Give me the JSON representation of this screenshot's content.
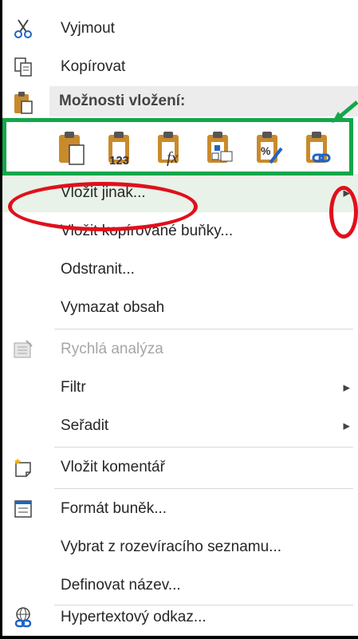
{
  "menu": {
    "cut_label": "Vyjmout",
    "copy_label": "Kopírovat",
    "paste_options_header": "Možnosti vložení:",
    "paste_special_label": "Vložit jinak...",
    "insert_copied_label": "Vložit kopírované buňky...",
    "delete_label": "Odstranit...",
    "clear_contents_label": "Vymazat obsah",
    "quick_analysis_label": "Rychlá analýza",
    "filter_label": "Filtr",
    "sort_label": "Seřadit",
    "insert_comment_label": "Vložit komentář",
    "format_cells_label": "Formát buněk...",
    "pick_from_list_label": "Vybrat z rozevíracího seznamu...",
    "define_name_label": "Definovat název...",
    "hyperlink_label": "Hypertextový odkaz...",
    "paste_values_badge": "123",
    "paste_formulas_badge": "fx",
    "paste_formatting_badge": "%"
  },
  "colors": {
    "annotation_green": "#14a64a",
    "annotation_red": "#e0101c",
    "clipboard_orange": "#c98a2c",
    "header_bg": "#ececec"
  },
  "icons": [
    "scissors-icon",
    "copy-icon",
    "paste-clipboard-icon",
    "paste-icon",
    "paste-values-icon",
    "paste-formulas-icon",
    "transpose-icon",
    "paste-formatting-icon",
    "paste-link-icon",
    "quick-analysis-icon",
    "submenu-arrow-icon",
    "new-comment-icon",
    "format-cells-icon",
    "hyperlink-icon"
  ]
}
